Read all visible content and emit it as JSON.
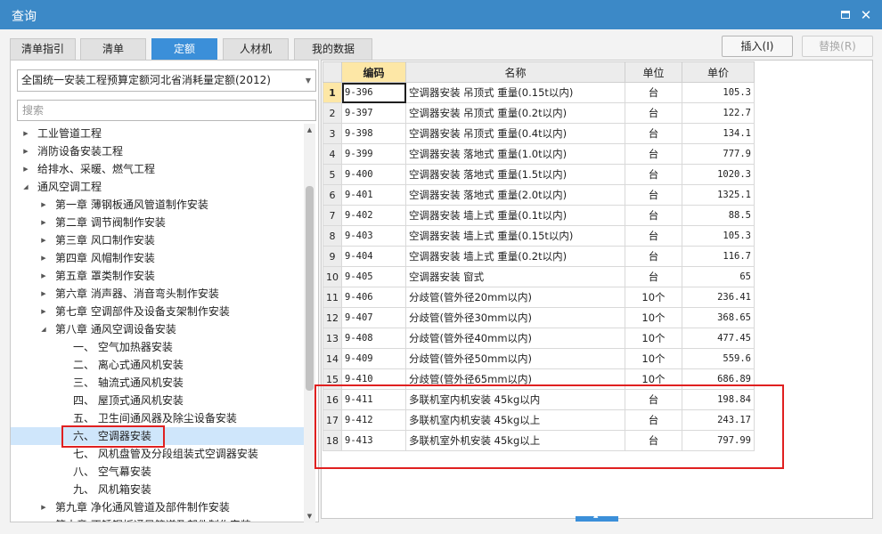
{
  "window": {
    "title": "查询",
    "close_glyph": "✕"
  },
  "tabs": [
    "清单指引",
    "清单",
    "定额",
    "人材机",
    "我的数据"
  ],
  "active_tab": 2,
  "actions": {
    "insert": "插入(I)",
    "replace": "替换(R)"
  },
  "left": {
    "dropdown_value": "全国统一安装工程预算定额河北省消耗量定额(2012)",
    "search_placeholder": "搜索",
    "tree": [
      {
        "label": "工业管道工程",
        "level": 1,
        "expander": "collapsed"
      },
      {
        "label": "消防设备安装工程",
        "level": 1,
        "expander": "collapsed"
      },
      {
        "label": "给排水、采暖、燃气工程",
        "level": 1,
        "expander": "collapsed"
      },
      {
        "label": "通风空调工程",
        "level": 1,
        "expander": "expanded"
      },
      {
        "label": "第一章 薄钢板通风管道制作安装",
        "level": 2,
        "expander": "collapsed"
      },
      {
        "label": "第二章 调节阀制作安装",
        "level": 2,
        "expander": "collapsed"
      },
      {
        "label": "第三章 风口制作安装",
        "level": 2,
        "expander": "collapsed"
      },
      {
        "label": "第四章 风帽制作安装",
        "level": 2,
        "expander": "collapsed"
      },
      {
        "label": "第五章 罩类制作安装",
        "level": 2,
        "expander": "collapsed"
      },
      {
        "label": "第六章 消声器、消音弯头制作安装",
        "level": 2,
        "expander": "collapsed"
      },
      {
        "label": "第七章 空调部件及设备支架制作安装",
        "level": 2,
        "expander": "collapsed"
      },
      {
        "label": "第八章 通风空调设备安装",
        "level": 2,
        "expander": "expanded"
      },
      {
        "label": "一、 空气加热器安装",
        "level": 3,
        "expander": "none"
      },
      {
        "label": "二、 离心式通风机安装",
        "level": 3,
        "expander": "none"
      },
      {
        "label": "三、 轴流式通风机安装",
        "level": 3,
        "expander": "none"
      },
      {
        "label": "四、 屋顶式通风机安装",
        "level": 3,
        "expander": "none"
      },
      {
        "label": "五、 卫生间通风器及除尘设备安装",
        "level": 3,
        "expander": "none"
      },
      {
        "label": "六、 空调器安装",
        "level": 3,
        "expander": "none",
        "selected": true
      },
      {
        "label": "七、 风机盘管及分段组装式空调器安装",
        "level": 3,
        "expander": "none"
      },
      {
        "label": "八、 空气幕安装",
        "level": 3,
        "expander": "none"
      },
      {
        "label": "九、 风机箱安装",
        "level": 3,
        "expander": "none"
      },
      {
        "label": "第九章 净化通风管道及部件制作安装",
        "level": 2,
        "expander": "collapsed"
      },
      {
        "label": "第十章 不锈钢板通风管道及部件制作安装",
        "level": 2,
        "expander": "collapsed"
      }
    ]
  },
  "grid": {
    "columns": [
      "编码",
      "名称",
      "单位",
      "单价"
    ],
    "rows": [
      {
        "no": "1",
        "code": "9-396",
        "name": "空调器安装 吊顶式 重量(0.15t以内)",
        "unit": "台",
        "price": "105.3"
      },
      {
        "no": "2",
        "code": "9-397",
        "name": "空调器安装 吊顶式 重量(0.2t以内)",
        "unit": "台",
        "price": "122.7"
      },
      {
        "no": "3",
        "code": "9-398",
        "name": "空调器安装 吊顶式 重量(0.4t以内)",
        "unit": "台",
        "price": "134.1"
      },
      {
        "no": "4",
        "code": "9-399",
        "name": "空调器安装 落地式 重量(1.0t以内)",
        "unit": "台",
        "price": "777.9"
      },
      {
        "no": "5",
        "code": "9-400",
        "name": "空调器安装 落地式 重量(1.5t以内)",
        "unit": "台",
        "price": "1020.3"
      },
      {
        "no": "6",
        "code": "9-401",
        "name": "空调器安装 落地式 重量(2.0t以内)",
        "unit": "台",
        "price": "1325.1"
      },
      {
        "no": "7",
        "code": "9-402",
        "name": "空调器安装 墙上式 重量(0.1t以内)",
        "unit": "台",
        "price": "88.5"
      },
      {
        "no": "8",
        "code": "9-403",
        "name": "空调器安装 墙上式 重量(0.15t以内)",
        "unit": "台",
        "price": "105.3"
      },
      {
        "no": "9",
        "code": "9-404",
        "name": "空调器安装 墙上式 重量(0.2t以内)",
        "unit": "台",
        "price": "116.7"
      },
      {
        "no": "10",
        "code": "9-405",
        "name": "空调器安装 窗式",
        "unit": "台",
        "price": "65"
      },
      {
        "no": "11",
        "code": "9-406",
        "name": "分歧管(管外径20mm以内)",
        "unit": "10个",
        "price": "236.41"
      },
      {
        "no": "12",
        "code": "9-407",
        "name": "分歧管(管外径30mm以内)",
        "unit": "10个",
        "price": "368.65"
      },
      {
        "no": "13",
        "code": "9-408",
        "name": "分歧管(管外径40mm以内)",
        "unit": "10个",
        "price": "477.45"
      },
      {
        "no": "14",
        "code": "9-409",
        "name": "分歧管(管外径50mm以内)",
        "unit": "10个",
        "price": "559.6"
      },
      {
        "no": "15",
        "code": "9-410",
        "name": "分歧管(管外径65mm以内)",
        "unit": "10个",
        "price": "686.89"
      },
      {
        "no": "16",
        "code": "9-411",
        "name": "多联机室内机安装 45kg以内",
        "unit": "台",
        "price": "198.84"
      },
      {
        "no": "17",
        "code": "9-412",
        "name": "多联机室内机安装 45kg以上",
        "unit": "台",
        "price": "243.17"
      },
      {
        "no": "18",
        "code": "9-413",
        "name": "多联机室外机安装 45kg以上",
        "unit": "台",
        "price": "797.99"
      }
    ]
  },
  "colors": {
    "titlebar": "#3c89c7",
    "active_tab": "#3b8fd9",
    "selection": "#cfe6fb",
    "highlight_box": "#e02020",
    "header_selected": "#fde7a6"
  },
  "icons": {
    "maximize": "maximize-icon",
    "close": "close-icon",
    "dropdown": "chevron-down-icon",
    "expand": "triangle-right-icon",
    "collapse": "triangle-down-icon"
  }
}
